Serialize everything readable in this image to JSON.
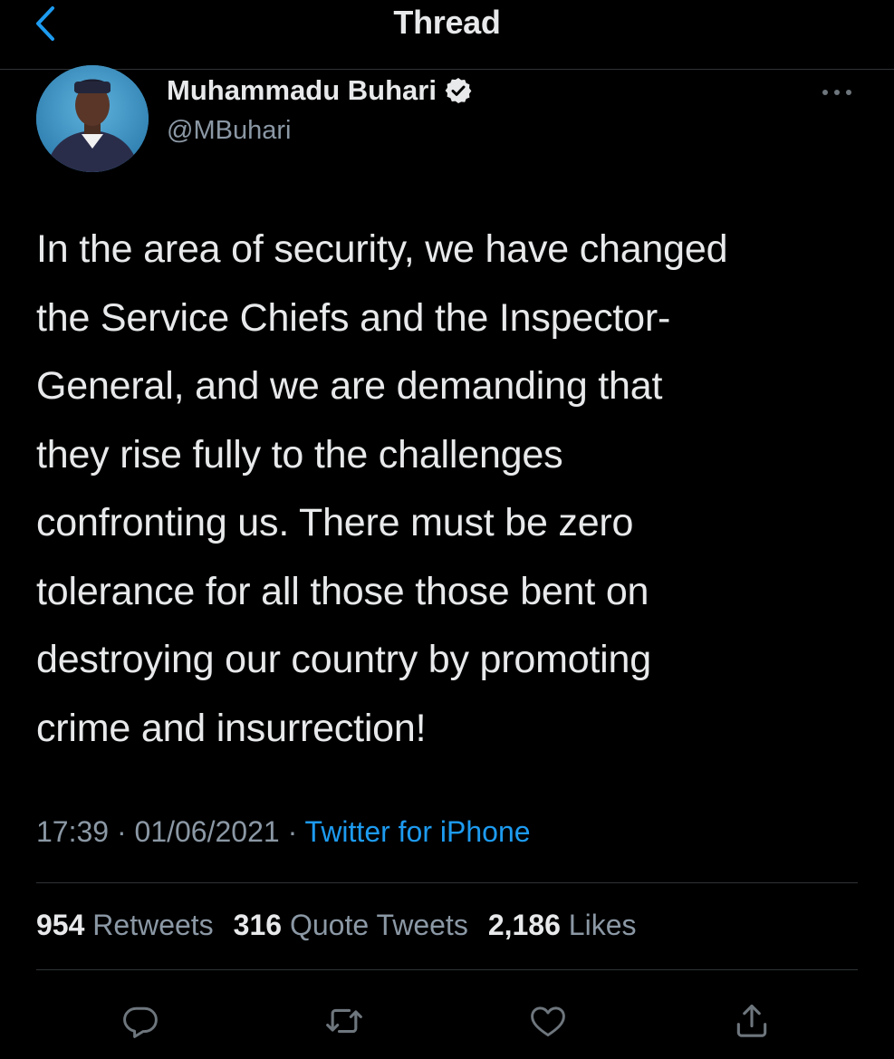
{
  "header": {
    "title": "Thread",
    "back_icon": "chevron-left-icon"
  },
  "author": {
    "name": "Muhammadu Buhari",
    "handle": "@MBuhari",
    "verified_icon": "verified-badge-icon"
  },
  "tweet": {
    "text": "In the area of security, we have changed\nthe Service Chiefs and the Inspector-\nGeneral, and we are demanding that\nthey rise fully to the challenges\nconfronting us. There must be zero\ntolerance for all those those bent on\ndestroying our country by promoting\ncrime and insurrection!",
    "time": "17:39",
    "date": "01/06/2021",
    "separator": "·",
    "source": "Twitter for iPhone"
  },
  "stats": {
    "retweets_count": "954",
    "retweets_label": "Retweets",
    "quotes_count": "316",
    "quotes_label": "Quote Tweets",
    "likes_count": "2,186",
    "likes_label": "Likes"
  },
  "actions": [
    {
      "icon": "reply-icon"
    },
    {
      "icon": "retweet-icon"
    },
    {
      "icon": "like-heart-icon"
    },
    {
      "icon": "share-icon"
    }
  ],
  "colors": {
    "background": "#000000",
    "text": "#e7e9ea",
    "secondary": "#8b98a5",
    "accent": "#1d9bf0",
    "divider": "#2f3336"
  }
}
